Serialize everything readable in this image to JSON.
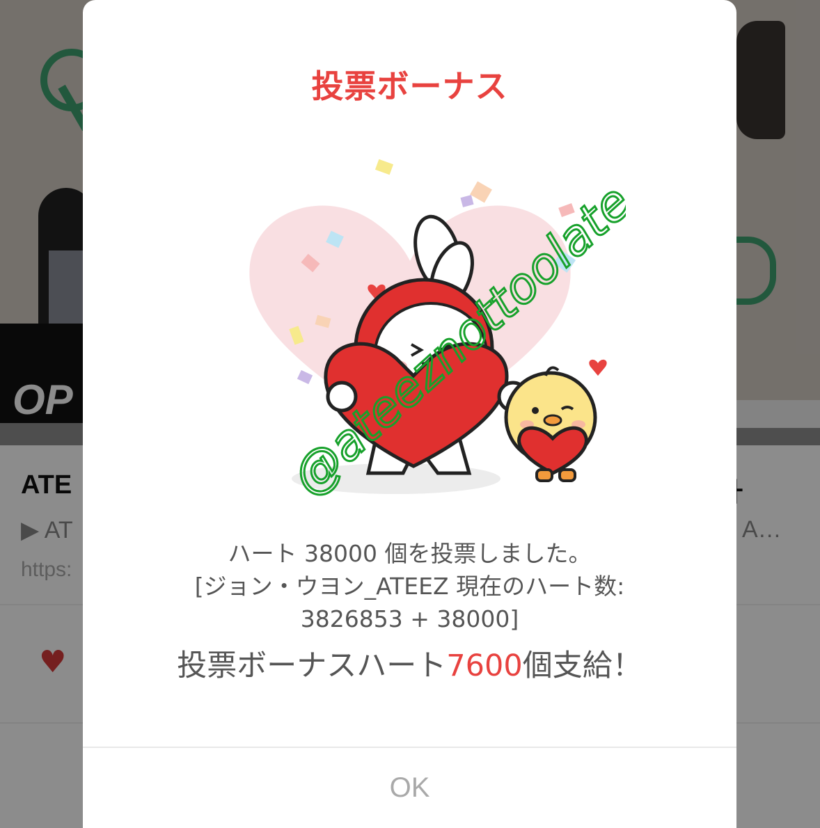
{
  "background": {
    "banner_text": "OP",
    "card_title_left": "ATE",
    "card_title_right": "ㅏ",
    "card_desc_left": "▶ AT",
    "card_desc_right": "A…",
    "card_url": "https:",
    "heart_icon": "heart-icon"
  },
  "dialog": {
    "title": "投票ボーナス",
    "message_line1": "ハート 38000 個を投票しました。",
    "message_line2": "[ジョン・ウヨン_ATEEZ 現在のハート数:",
    "message_line3": "3826853 + 38000]",
    "bonus_prefix": "投票ボーナスハート",
    "bonus_value": "7600",
    "bonus_suffix": "個支給！",
    "ok_label": "OK"
  },
  "watermark": "@ateeznottoolate",
  "colors": {
    "accent_red": "#e8423f",
    "text_gray": "#555555",
    "ok_gray": "#a9a9a9",
    "watermark_green": "#17a12b"
  }
}
